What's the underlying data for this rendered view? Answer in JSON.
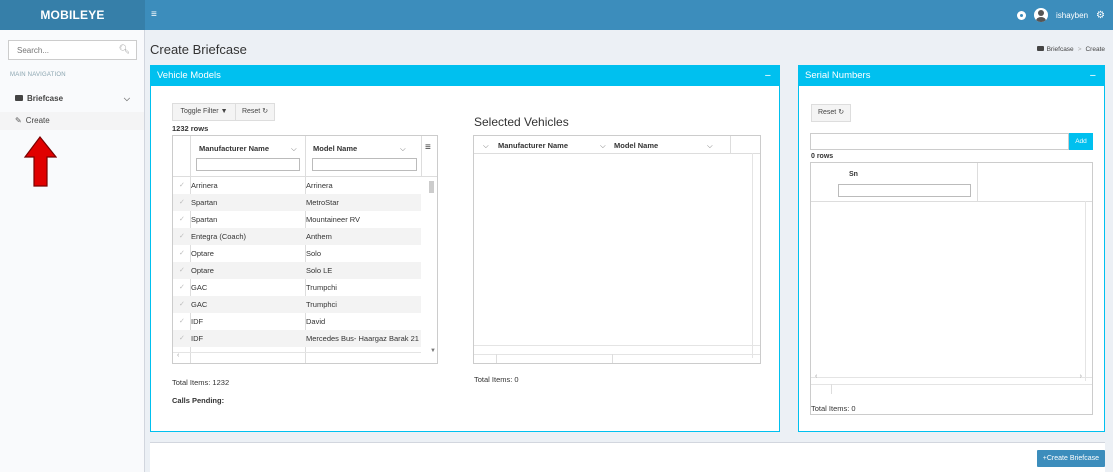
{
  "header": {
    "logo_bold": "MOBIL",
    "logo_rest": "EYE",
    "menu_icon": "≡",
    "username": "ishayben"
  },
  "sidebar": {
    "search_placeholder": "Search...",
    "nav_header": "MAIN NAVIGATION",
    "briefcase_label": "Briefcase",
    "create_label": "Create"
  },
  "page": {
    "title": "Create Briefcase",
    "breadcrumb": [
      "Briefcase",
      "Create"
    ]
  },
  "vehicle_models": {
    "title": "Vehicle Models",
    "toggle_filter": "Toggle Filter",
    "reset": "Reset",
    "row_count": "1232 rows",
    "columns": [
      "Manufacturer Name",
      "Model Name"
    ],
    "rows": [
      [
        "Arrinera",
        "Arrinera"
      ],
      [
        "Spartan",
        "MetroStar"
      ],
      [
        "Spartan",
        "Mountaineer RV"
      ],
      [
        "Entegra (Coach)",
        "Anthem"
      ],
      [
        "Optare",
        "Solo"
      ],
      [
        "Optare",
        "Solo LE"
      ],
      [
        "GAC",
        "Trumpchi"
      ],
      [
        "GAC",
        "Trumphci"
      ],
      [
        "IDF",
        "David"
      ],
      [
        "IDF",
        "Mercedes Bus- Haargaz Barak 21"
      ]
    ],
    "total": "Total Items: 1232",
    "calls_pending": "Calls Pending:"
  },
  "selected_vehicles": {
    "title": "Selected Vehicles",
    "columns": [
      "Manufacturer Name",
      "Model Name"
    ],
    "total": "Total Items: 0"
  },
  "serial_numbers": {
    "title": "Serial Numbers",
    "reset": "Reset",
    "add": "Add",
    "row_count": "0 rows",
    "column": "Sn",
    "total": "Total Items: 0"
  },
  "footer": {
    "create_button": "Create Briefcase"
  }
}
